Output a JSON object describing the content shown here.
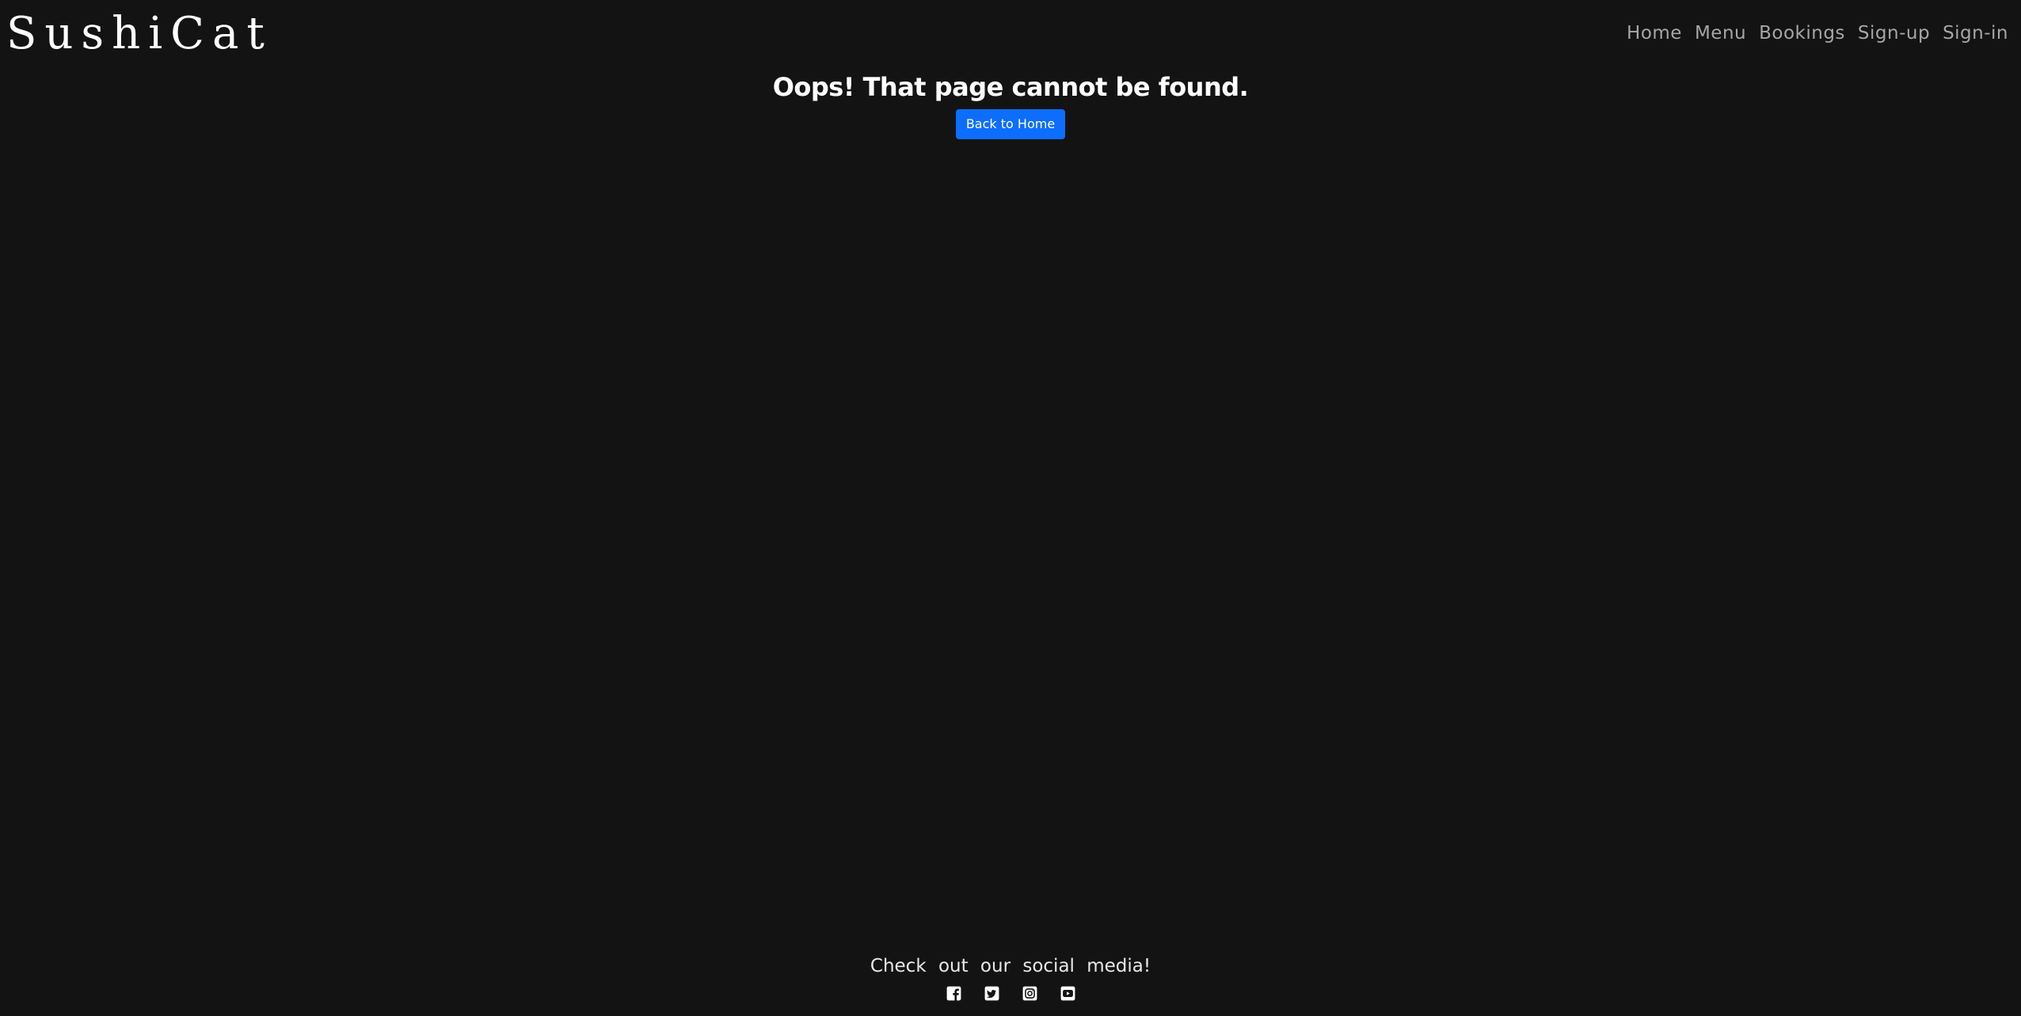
{
  "navbar": {
    "brand": "SushiCat",
    "links": [
      {
        "label": "Home"
      },
      {
        "label": "Menu"
      },
      {
        "label": "Bookings"
      },
      {
        "label": "Sign-up"
      },
      {
        "label": "Sign-in"
      }
    ]
  },
  "main": {
    "title": "Oops! That page cannot be found.",
    "button_label": "Back to Home"
  },
  "footer": {
    "text": "Check out our social media!",
    "socials": [
      {
        "icon": "facebook-icon"
      },
      {
        "icon": "twitter-icon"
      },
      {
        "icon": "instagram-icon"
      },
      {
        "icon": "youtube-icon"
      }
    ]
  },
  "colors": {
    "background": "#141314",
    "accent": "#0d6efd",
    "nav_link": "#a6a6a6"
  }
}
